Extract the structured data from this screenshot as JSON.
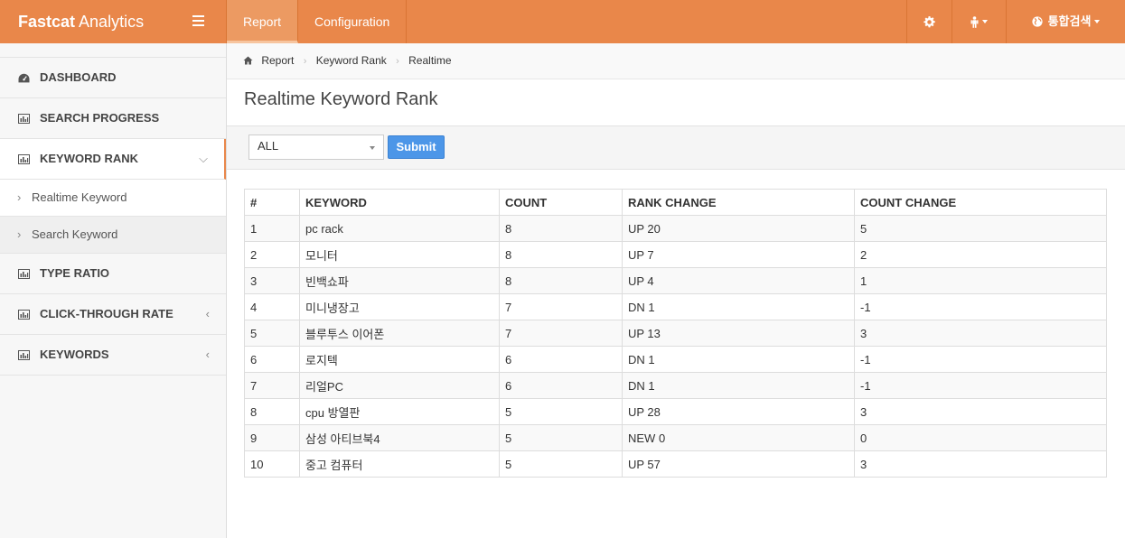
{
  "brand": {
    "bold": "Fastcat",
    "light": " Analytics"
  },
  "topnav": [
    {
      "label": "Report"
    },
    {
      "label": "Configuration"
    }
  ],
  "topright": {
    "search_label": "통합검색"
  },
  "sidebar": {
    "items": [
      {
        "label": "DASHBOARD"
      },
      {
        "label": "SEARCH PROGRESS"
      },
      {
        "label": "KEYWORD RANK"
      },
      {
        "label": "TYPE RATIO"
      },
      {
        "label": "CLICK-THROUGH RATE"
      },
      {
        "label": "KEYWORDS"
      }
    ],
    "subitems": [
      {
        "label": "Realtime Keyword"
      },
      {
        "label": "Search Keyword"
      }
    ]
  },
  "breadcrumb": [
    "Report",
    "Keyword Rank",
    "Realtime"
  ],
  "page_title": "Realtime Keyword Rank",
  "filter": {
    "selected": "ALL",
    "submit_label": "Submit"
  },
  "table": {
    "headers": [
      "#",
      "KEYWORD",
      "COUNT",
      "RANK CHANGE",
      "COUNT CHANGE"
    ],
    "rows": [
      [
        "1",
        "pc rack",
        "8",
        "UP 20",
        "5"
      ],
      [
        "2",
        "모니터",
        "8",
        "UP 7",
        "2"
      ],
      [
        "3",
        "빈백쇼파",
        "8",
        "UP 4",
        "1"
      ],
      [
        "4",
        "미니냉장고",
        "7",
        "DN 1",
        "-1"
      ],
      [
        "5",
        "블루투스 이어폰",
        "7",
        "UP 13",
        "3"
      ],
      [
        "6",
        "로지텍",
        "6",
        "DN 1",
        "-1"
      ],
      [
        "7",
        "리얼PC",
        "6",
        "DN 1",
        "-1"
      ],
      [
        "8",
        "cpu 방열판",
        "5",
        "UP 28",
        "3"
      ],
      [
        "9",
        "삼성 아티브북4",
        "5",
        "NEW 0",
        "0"
      ],
      [
        "10",
        "중고 컴퓨터",
        "5",
        "UP 57",
        "3"
      ]
    ]
  },
  "colors": {
    "accent": "#e9874a",
    "submit": "#4c96e8"
  }
}
